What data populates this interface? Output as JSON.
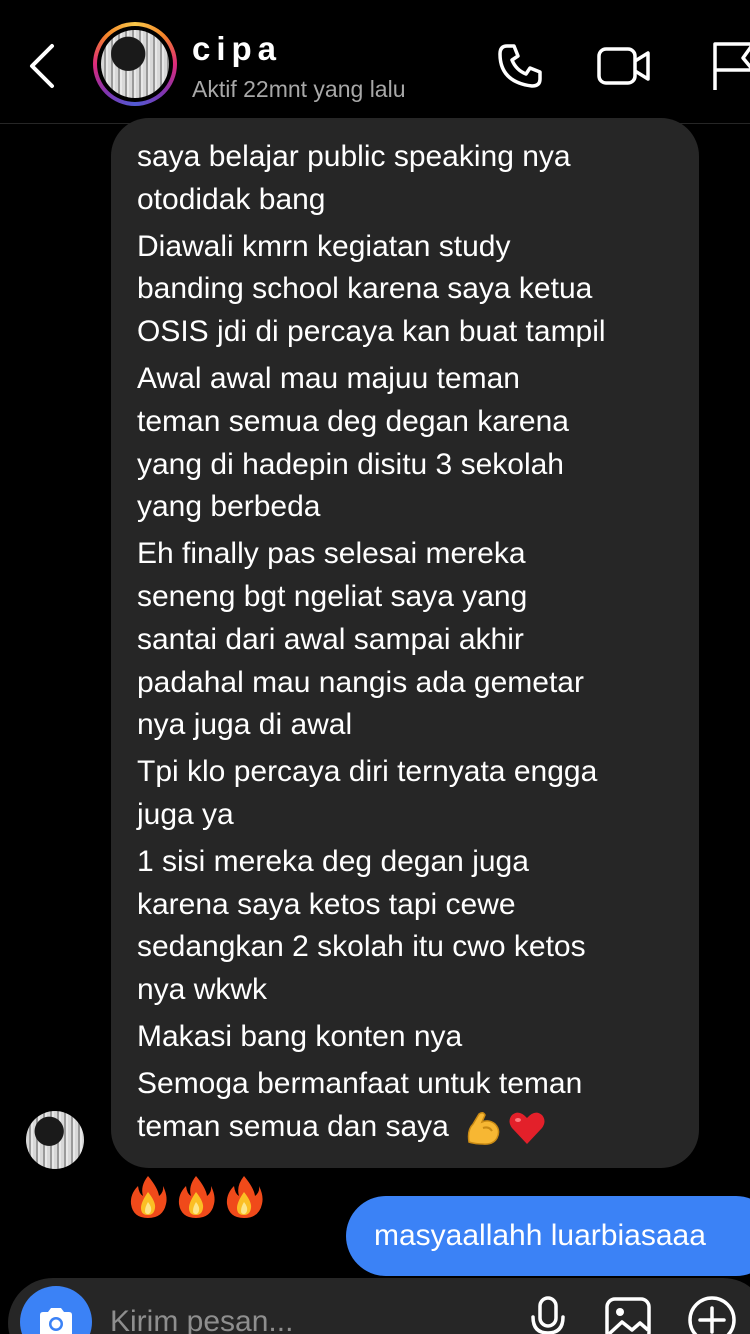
{
  "header": {
    "contact_name": "cipa",
    "status": "Aktif 22mnt yang lalu",
    "icons": [
      "back-icon",
      "phone-icon",
      "video-icon",
      "flag-icon"
    ]
  },
  "messages": {
    "incoming": {
      "lines": [
        "saya belajar public speaking nya",
        "otodidak bang",
        "Diawali kmrn kegiatan study",
        "banding school karena saya ketua",
        "OSIS jdi di percaya kan buat tampil",
        "Awal awal mau majuu teman",
        "teman semua deg degan karena",
        "yang di hadepin disitu 3 sekolah",
        "yang berbeda",
        "Eh finally pas selesai mereka",
        "seneng bgt ngeliat saya yang",
        "santai dari awal sampai akhir",
        "padahal mau nangis ada gemetar",
        "nya juga di awal",
        "Tpi klo percaya diri ternyata engga",
        "juga ya",
        "1 sisi mereka deg degan juga",
        "karena saya ketos tapi cewe",
        "sedangkan 2 skolah itu cwo ketos",
        "nya wkwk",
        "Makasi bang konten nya",
        "Semoga bermanfaat untuk teman",
        "teman semua dan saya"
      ],
      "trailing_emojis": [
        "flexed-biceps-emoji",
        "red-heart-emoji"
      ]
    },
    "reactions": [
      "fire-emoji",
      "fire-emoji",
      "fire-emoji"
    ],
    "outgoing": {
      "text": "masyaallahh luarbiasaaa"
    }
  },
  "composer": {
    "placeholder": "Kirim pesan...",
    "icons": [
      "camera-icon",
      "microphone-icon",
      "gallery-icon",
      "add-icon"
    ]
  },
  "colors": {
    "background": "#000000",
    "incoming_bubble": "#262626",
    "outgoing_bubble": "#3b82f6",
    "status_text": "#a8a8a8"
  }
}
